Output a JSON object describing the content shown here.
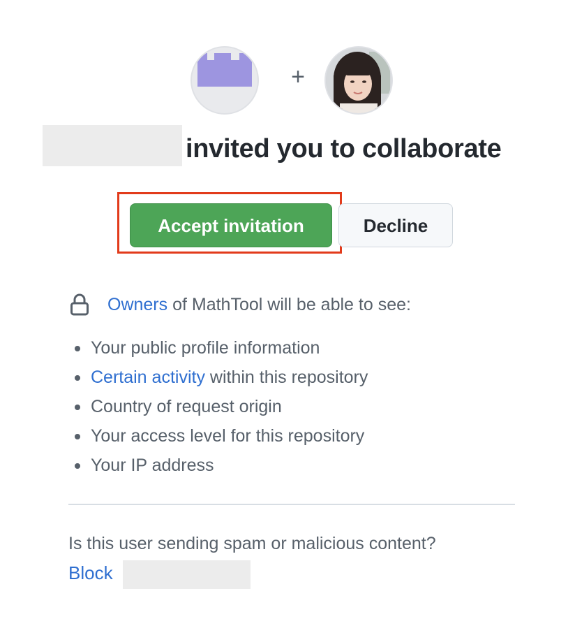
{
  "avatars": {
    "org_icon": "castle-icon",
    "org_icon_color": "#9d95e0",
    "user_photo": "user-avatar-photo"
  },
  "join_symbol": "+",
  "title": {
    "text": "invited you to collaborate"
  },
  "actions": {
    "accept_label": "Accept invitation",
    "decline_label": "Decline",
    "accept_color": "#4da557",
    "highlight_color": "#e23b1b"
  },
  "visibility": {
    "icon": "lock-icon",
    "owners_link": "Owners",
    "intro_rest": " of MathTool will be able to see:",
    "items": [
      {
        "text": "Your public profile information"
      },
      {
        "link": "Certain activity",
        "text": " within this repository"
      },
      {
        "text": "Country of request origin"
      },
      {
        "text": "Your access level for this repository"
      },
      {
        "text": "Your IP address"
      }
    ]
  },
  "spam": {
    "question": "Is this user sending spam or malicious content?",
    "block_label": "Block"
  },
  "colors": {
    "link": "#2f6fd0",
    "muted_text": "#57606a",
    "heading_text": "#24292f"
  }
}
